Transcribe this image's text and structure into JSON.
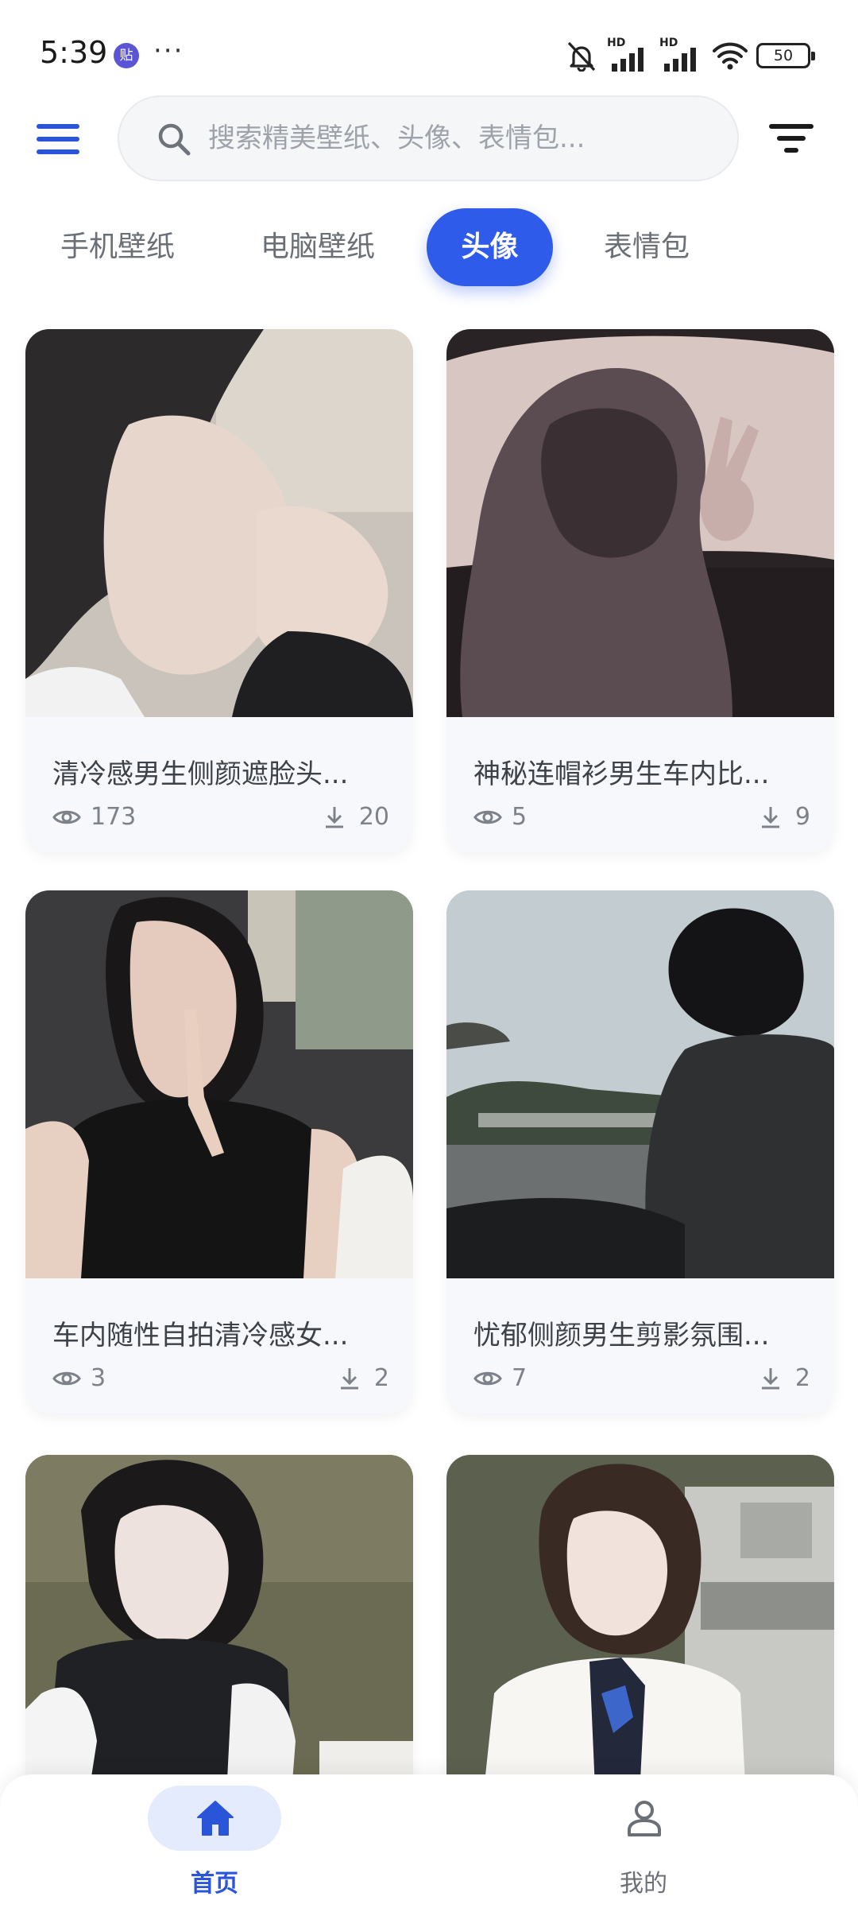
{
  "status_bar": {
    "time": "5:39",
    "sticker_badge": "贴",
    "more": "···",
    "signal_1_label": "HD",
    "signal_2_label": "HD",
    "battery": "50"
  },
  "search": {
    "placeholder": "搜索精美壁纸、头像、表情包..."
  },
  "tabs": [
    {
      "label": "手机壁纸",
      "active": false
    },
    {
      "label": "电脑壁纸",
      "active": false
    },
    {
      "label": "头像",
      "active": true
    },
    {
      "label": "表情包",
      "active": false
    }
  ],
  "cards": [
    {
      "title": "清冷感男生侧颜遮脸头...",
      "views": "173",
      "downloads": "20"
    },
    {
      "title": "神秘连帽衫男生车内比...",
      "views": "5",
      "downloads": "9"
    },
    {
      "title": "车内随性自拍清冷感女...",
      "views": "3",
      "downloads": "2"
    },
    {
      "title": "忧郁侧颜男生剪影氛围...",
      "views": "7",
      "downloads": "2"
    },
    {
      "title": "",
      "views": "",
      "downloads": ""
    },
    {
      "title": "",
      "views": "",
      "downloads": ""
    }
  ],
  "bottom_nav": {
    "home_label": "首页",
    "mine_label": "我的"
  },
  "colors": {
    "accent": "#2f5bea",
    "menu_icon": "#2b55d9",
    "card_bg": "#f7f8fb",
    "active_nav_pill": "#e4ebfc"
  }
}
